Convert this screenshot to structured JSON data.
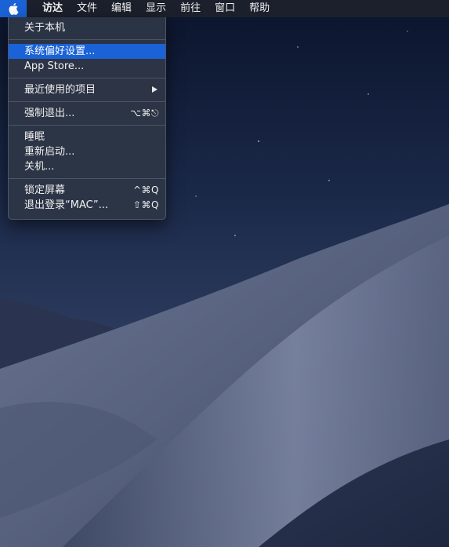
{
  "menubar": {
    "apple_icon": "apple-logo-icon",
    "items": [
      {
        "label": "访达"
      },
      {
        "label": "文件"
      },
      {
        "label": "编辑"
      },
      {
        "label": "显示"
      },
      {
        "label": "前往"
      },
      {
        "label": "窗口"
      },
      {
        "label": "帮助"
      }
    ]
  },
  "apple_menu": {
    "about": "关于本机",
    "preferences": "系统偏好设置...",
    "app_store": "App Store...",
    "recent_items": "最近使用的项目",
    "force_quit": "强制退出...",
    "force_quit_shortcut": "⌥⌘⎋",
    "sleep": "睡眠",
    "restart": "重新启动...",
    "shutdown": "关机...",
    "lock_screen": "锁定屏幕",
    "lock_screen_shortcut": "^⌘Q",
    "logout": "退出登录“MAC”...",
    "logout_shortcut": "⇧⌘Q"
  },
  "colors": {
    "highlight": "#1a62d6",
    "menubar_bg": "#1e222c",
    "menu_bg": "#2e3646"
  }
}
